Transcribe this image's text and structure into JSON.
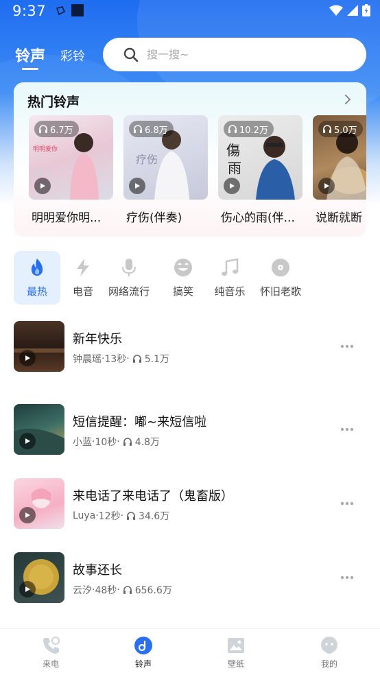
{
  "status_bar": {
    "time": "9:37"
  },
  "header": {
    "tabs": [
      {
        "label": "铃声"
      },
      {
        "label": "彩铃"
      }
    ],
    "search": {
      "placeholder": "搜一搜~"
    }
  },
  "hot": {
    "title": "热门铃声",
    "albums": [
      {
        "name": "明明爱你明...",
        "plays": "6.7万"
      },
      {
        "name": "疗伤(伴奏)",
        "plays": "6.8万"
      },
      {
        "name": "伤心的雨(伴...",
        "plays": "10.2万"
      },
      {
        "name": "说断就断",
        "plays": "5.0万"
      }
    ]
  },
  "categories": [
    {
      "label": "最热",
      "icon": "fire-icon"
    },
    {
      "label": "电音",
      "icon": "lightning-icon"
    },
    {
      "label": "网络流行",
      "icon": "microphone-icon"
    },
    {
      "label": "搞笑",
      "icon": "smile-icon"
    },
    {
      "label": "纯音乐",
      "icon": "music-note-icon"
    },
    {
      "label": "怀旧老歌",
      "icon": "vinyl-icon"
    }
  ],
  "songs": [
    {
      "title": "新年快乐",
      "artist": "钟晨瑶",
      "duration": "13秒",
      "plays": "5.1万"
    },
    {
      "title": "短信提醒：嘟~来短信啦",
      "artist": "小蓝",
      "duration": "10秒",
      "plays": "4.8万"
    },
    {
      "title": "来电话了来电话了（鬼畜版）",
      "artist": "Luya",
      "duration": "12秒",
      "plays": "34.6万"
    },
    {
      "title": "故事还长",
      "artist": "云汐",
      "duration": "48秒",
      "plays": "656.6万"
    }
  ],
  "meta_separator": " · ",
  "bottom_nav": [
    {
      "label": "来电",
      "icon": "phone-icon"
    },
    {
      "label": "铃声",
      "icon": "ringtone-icon"
    },
    {
      "label": "壁纸",
      "icon": "wallpaper-icon"
    },
    {
      "label": "我的",
      "icon": "profile-icon"
    }
  ],
  "colors": {
    "accent": "#2a6ff0",
    "header_blue": "#1f6df0"
  }
}
